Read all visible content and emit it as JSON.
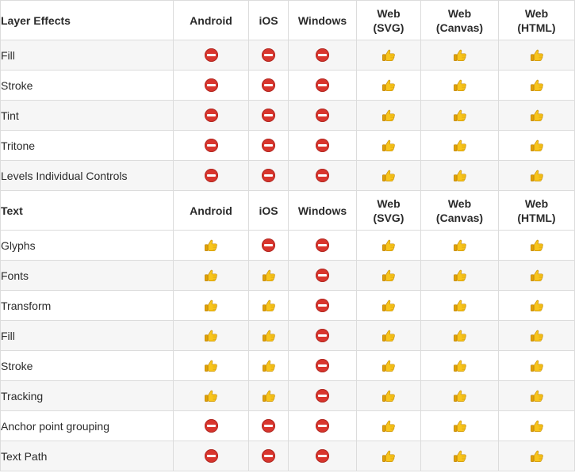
{
  "columns": [
    "Android",
    "iOS",
    "Windows",
    "Web\n(SVG)",
    "Web\n(Canvas)",
    "Web\n(HTML)"
  ],
  "colors": {
    "supported": "#f5c21a",
    "unsupported": "#d9352d",
    "stripe": "#f6f6f6",
    "border": "#dcdcdc"
  },
  "icons": {
    "supported": "thumbs-up-icon",
    "unsupported": "no-entry-icon"
  },
  "sections": [
    {
      "title": "Layer Effects",
      "rows": [
        {
          "feature": "Fill",
          "support": [
            false,
            false,
            false,
            true,
            true,
            true
          ]
        },
        {
          "feature": "Stroke",
          "support": [
            false,
            false,
            false,
            true,
            true,
            true
          ]
        },
        {
          "feature": "Tint",
          "support": [
            false,
            false,
            false,
            true,
            true,
            true
          ]
        },
        {
          "feature": "Tritone",
          "support": [
            false,
            false,
            false,
            true,
            true,
            true
          ]
        },
        {
          "feature": "Levels Individual Controls",
          "support": [
            false,
            false,
            false,
            true,
            true,
            true
          ]
        }
      ]
    },
    {
      "title": "Text",
      "rows": [
        {
          "feature": "Glyphs",
          "support": [
            true,
            false,
            false,
            true,
            true,
            true
          ]
        },
        {
          "feature": "Fonts",
          "support": [
            true,
            true,
            false,
            true,
            true,
            true
          ]
        },
        {
          "feature": "Transform",
          "support": [
            true,
            true,
            false,
            true,
            true,
            true
          ]
        },
        {
          "feature": "Fill",
          "support": [
            true,
            true,
            false,
            true,
            true,
            true
          ]
        },
        {
          "feature": "Stroke",
          "support": [
            true,
            true,
            false,
            true,
            true,
            true
          ]
        },
        {
          "feature": "Tracking",
          "support": [
            true,
            true,
            false,
            true,
            true,
            true
          ]
        },
        {
          "feature": "Anchor point grouping",
          "support": [
            false,
            false,
            false,
            true,
            true,
            true
          ]
        },
        {
          "feature": "Text Path",
          "support": [
            false,
            false,
            false,
            true,
            true,
            true
          ]
        }
      ]
    }
  ]
}
